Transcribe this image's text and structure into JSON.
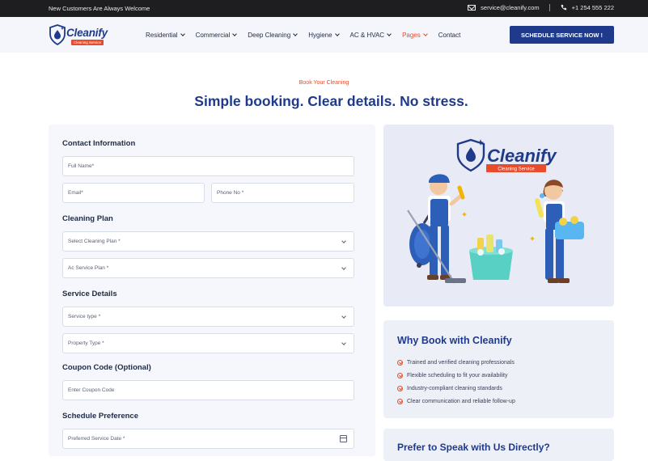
{
  "topbar": {
    "welcome": "New Customers Are Always Welcome",
    "email": "service@cleanify.com",
    "phone": "+1 254 555 222"
  },
  "logo": {
    "word": "Cleanify",
    "tagline": "Cleaning Service"
  },
  "nav": {
    "items": [
      {
        "label": "Residential",
        "dropdown": true
      },
      {
        "label": "Commercial",
        "dropdown": true
      },
      {
        "label": "Deep Cleaning",
        "dropdown": true
      },
      {
        "label": "Hygiene",
        "dropdown": true
      },
      {
        "label": "AC & HVAC",
        "dropdown": true
      },
      {
        "label": "Pages",
        "dropdown": true,
        "active": true
      },
      {
        "label": "Contact",
        "dropdown": false
      }
    ],
    "cta": "SCHEDULE SERVICE NOW !"
  },
  "hero": {
    "eyebrow": "Book Your Cleaning",
    "headline": "Simple booking. Clear details. No stress."
  },
  "form": {
    "contact_title": "Contact Information",
    "full_name_placeholder": "Full Name*",
    "email_placeholder": "Email*",
    "phone_placeholder": "Phone No *",
    "plan_title": "Cleaning Plan",
    "plan_select": "Select Cleaning Plan *",
    "ac_select": "Ac Service Plan *",
    "service_title": "Service Details",
    "service_type": "Service type *",
    "property_type": "Property Type *",
    "coupon_title": "Coupon Code (Optional)",
    "coupon_placeholder": "Enter Coupon Code",
    "schedule_title": "Schedule Preference",
    "date_placeholder": "Preferred Service Date *"
  },
  "illustration": {
    "brand": "Cleanify",
    "tagline": "Cleaning Service"
  },
  "why": {
    "title": "Why Book with Cleanify",
    "items": [
      "Trained and verified cleaning professionals",
      "Flexible scheduling to fit your availability",
      "Industry-compliant cleaning standards",
      "Clear communication and reliable follow-up"
    ]
  },
  "next": {
    "title": "Prefer to Speak with Us Directly?"
  },
  "colors": {
    "brand_blue": "#1f3a8a",
    "accent": "#e84c2c",
    "topbar": "#1e1e21"
  }
}
